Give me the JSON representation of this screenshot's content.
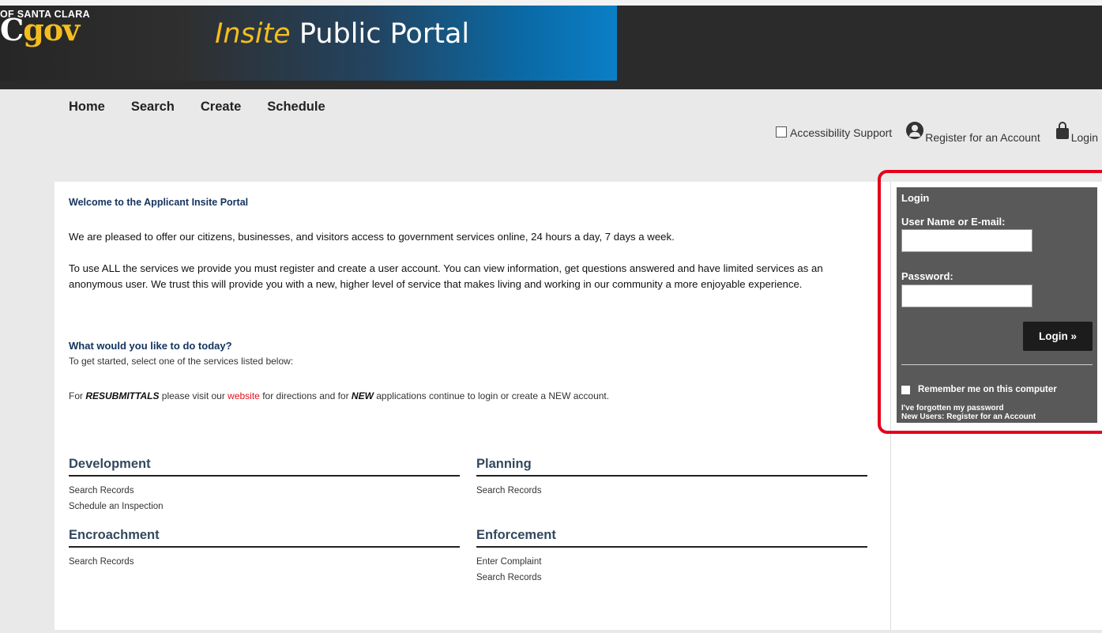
{
  "header": {
    "org": "OF SANTA CLARA",
    "logo_c": "C",
    "logo_gov": "gov",
    "portal_em": "Insite",
    "portal_rest": " Public Portal"
  },
  "nav": {
    "home": "Home",
    "search": "Search",
    "create": "Create",
    "schedule": "Schedule"
  },
  "util": {
    "accessibility": "Accessibility Support",
    "register": "Register for an Account",
    "login": "Login"
  },
  "main": {
    "welcome_title": "Welcome to the Applicant Insite Portal",
    "p1": "We are pleased to offer our citizens, businesses, and visitors access to government services online, 24 hours a day, 7 days a week.",
    "p2": "To use ALL the services we provide you must register and create a user account. You can view information, get questions answered and have limited services as an anonymous user. We trust this will provide you with a new, higher level of service that makes living and working in our community a more enjoyable experience.",
    "question_title": "What would you like to do today?",
    "question_sub": "To get started, select one of the services listed below:",
    "resub_prefix": "For ",
    "resub_bold": "RESUBMITTALS",
    "resub_mid": " please visit our ",
    "resub_link": "website",
    "resub_mid2": " for directions and for ",
    "resub_new": "NEW",
    "resub_suffix": " applications continue to login or create a NEW account."
  },
  "sections": {
    "development": {
      "title": "Development",
      "links": [
        "Search Records",
        "Schedule an Inspection"
      ]
    },
    "planning": {
      "title": "Planning",
      "links": [
        "Search Records"
      ]
    },
    "encroachment": {
      "title": "Encroachment",
      "links": [
        "Search Records"
      ]
    },
    "enforcement": {
      "title": "Enforcement",
      "links": [
        "Enter Complaint",
        "Search Records"
      ]
    }
  },
  "login_box": {
    "title": "Login",
    "user_label": "User Name or E-mail:",
    "user_value": "",
    "password_label": "Password:",
    "password_value": "",
    "button": "Login »",
    "remember": "Remember me on this computer",
    "forgot": "I've forgotten my password",
    "new_users_label": "New Users:",
    "new_users_link": "Register for an Account"
  },
  "colors": {
    "accent_yellow": "#f4bd1f",
    "highlight_red": "#e4001b",
    "link_red": "#e0121b",
    "navy": "#13335e"
  }
}
